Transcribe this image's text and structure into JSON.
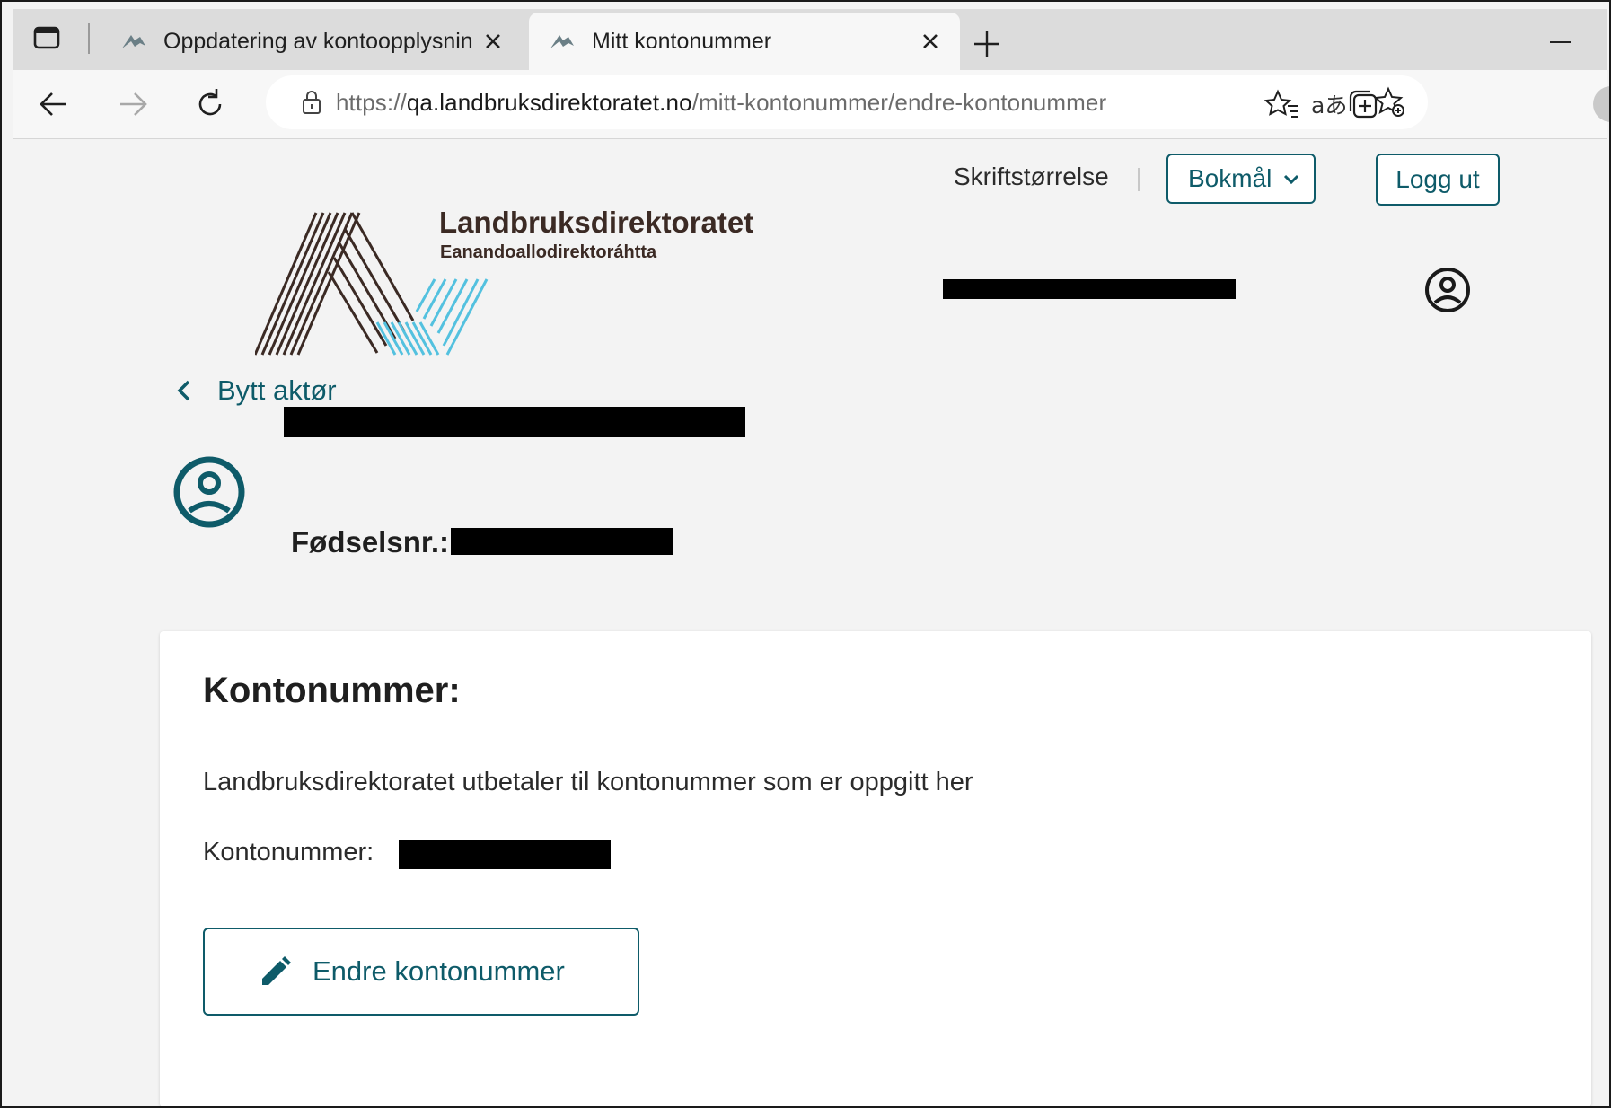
{
  "browser": {
    "tabs": [
      {
        "title": "Oppdatering av kontoopplysning",
        "active": false
      },
      {
        "title": "Mitt kontonummer",
        "active": true
      }
    ],
    "url_scheme": "https://",
    "url_host": "qa.landbruksdirektoratet.no",
    "url_path": "/mitt-kontonummer/endre-kontonummer",
    "read_aloud_glyph": "aあ"
  },
  "header": {
    "font_size_label": "Skriftstørrelse",
    "language_selected": "Bokmål",
    "logout_label": "Logg ut"
  },
  "logo": {
    "title": "Landbruksdirektoratet",
    "subtitle": "Eanandoallodirektoráhtta",
    "colors": {
      "brown": "#3b2a24",
      "teal": "#53c1df"
    }
  },
  "nav": {
    "back_label": "Bytt aktør"
  },
  "actor": {
    "fnr_label": "Fødselsnr.:"
  },
  "account_card": {
    "heading": "Kontonummer:",
    "description": "Landbruksdirektoratet utbetaler til kontonummer som er oppgitt her",
    "account_label": "Kontonummer:",
    "edit_button_label": "Endre kontonummer"
  },
  "colors": {
    "primary": "#0e5b69",
    "redaction": "#000000",
    "page_bg": "#f3f3f3"
  },
  "icons": [
    "tab-actions-icon",
    "favicon-icon",
    "close-icon",
    "plus-icon",
    "back-arrow-icon",
    "forward-arrow-icon",
    "refresh-icon",
    "lock-icon",
    "read-aloud-icon",
    "add-favorite-icon",
    "favorites-icon",
    "collections-icon",
    "chevron-down-icon",
    "user-circle-icon",
    "chevron-left-icon",
    "pencil-icon"
  ]
}
